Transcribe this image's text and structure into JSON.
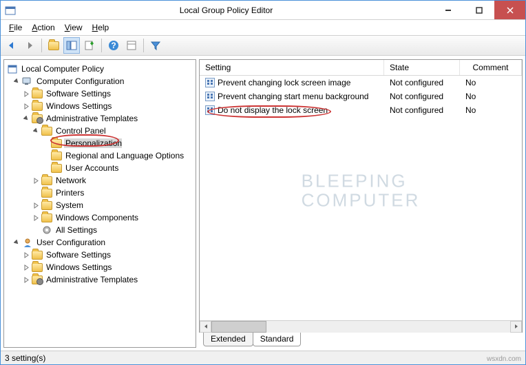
{
  "title": "Local Group Policy Editor",
  "menus": {
    "file": "File",
    "action": "Action",
    "view": "View",
    "help": "Help"
  },
  "tree": {
    "root": "Local Computer Policy",
    "computer": "Computer Configuration",
    "softwareSettings": "Software Settings",
    "windowsSettings": "Windows Settings",
    "adminTemplates": "Administrative Templates",
    "controlPanel": "Control Panel",
    "personalization": "Personalization",
    "regional": "Regional and Language Options",
    "userAccounts": "User Accounts",
    "network": "Network",
    "printers": "Printers",
    "system": "System",
    "windowsComponents": "Windows Components",
    "allSettings": "All Settings",
    "user": "User Configuration",
    "softwareSettings2": "Software Settings",
    "windowsSettings2": "Windows Settings",
    "adminTemplates2": "Administrative Templates"
  },
  "columns": {
    "setting": "Setting",
    "state": "State",
    "comment": "Comment"
  },
  "rows": [
    {
      "name": "Prevent changing lock screen image",
      "state": "Not configured",
      "comment": "No"
    },
    {
      "name": "Prevent changing start menu background",
      "state": "Not configured",
      "comment": "No"
    },
    {
      "name": "Do not display the lock screen",
      "state": "Not configured",
      "comment": "No"
    }
  ],
  "tabs": {
    "extended": "Extended",
    "standard": "Standard"
  },
  "status": "3 setting(s)",
  "watermark": {
    "l1": "BLEEPING",
    "l2": "COMPUTER"
  },
  "attribution": "wsxdn.com"
}
